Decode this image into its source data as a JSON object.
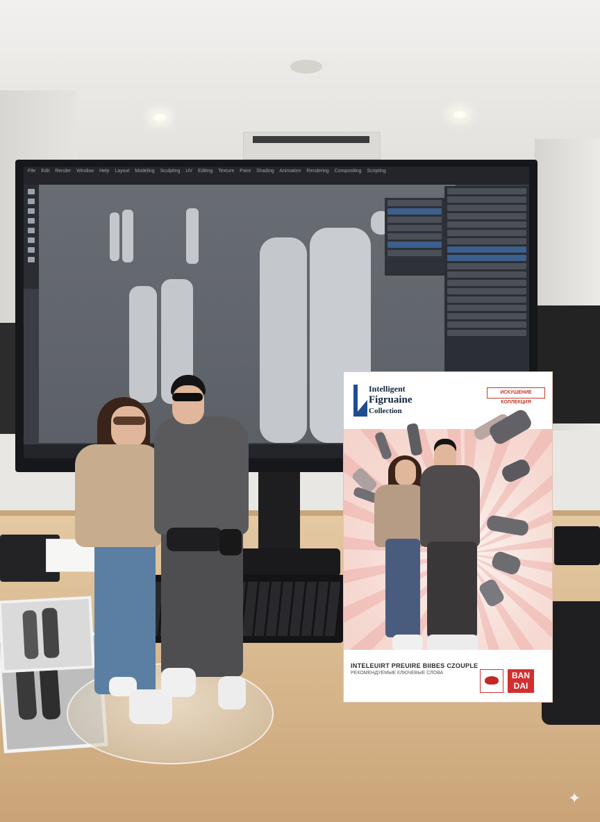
{
  "scene": {
    "box": {
      "brand_line_1": "Intelligent",
      "brand_line_2": "Figruaine",
      "brand_line_3": "Collection",
      "badge_text": "ИСКУШЕНИЕ КОЛЛЕКЦИЯ",
      "subtitle": "INTELEUIRT PREUIRE BIIBES CZOUPLE",
      "subtitle_small": "РЕКОМЕНДУЕМЫЕ КЛЮЧЕВЫЕ СЛОВА",
      "maker_logo": "BAN\nDAI"
    },
    "software": {
      "menu_items": [
        "File",
        "Edit",
        "Render",
        "Window",
        "Help",
        "Layout",
        "Modeling",
        "Sculpting",
        "UV Editing",
        "Texture Paint",
        "Shading",
        "Animation",
        "Rendering",
        "Compositing",
        "Scripting"
      ]
    },
    "colors": {
      "desk": "#d9b78d",
      "box_accent": "#d32f2f",
      "box_logo": "#1f4d8f"
    }
  }
}
